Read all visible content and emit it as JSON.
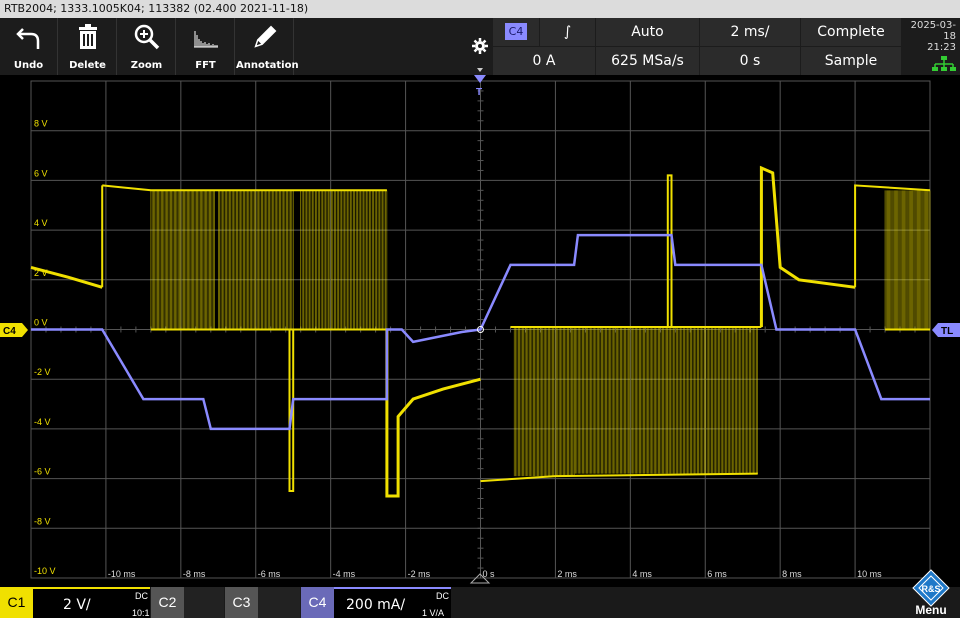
{
  "title_bar": {
    "text": "RTB2004; 1333.1005K04; 113382 (02.400 2021-11-18)"
  },
  "toolbar": {
    "undo_label": "Undo",
    "delete_label": "Delete",
    "zoom_label": "Zoom",
    "fft_label": "FFT",
    "annotation_label": "Annotation"
  },
  "trigger": {
    "source": "C4",
    "slope_symbol": "∫",
    "mode": "Auto",
    "level": "0 A",
    "sample_rate": "625 MSa/s"
  },
  "timebase": {
    "scale": "2 ms/",
    "position": "0 s"
  },
  "acquisition": {
    "status": "Complete",
    "mode": "Sample"
  },
  "datetime": {
    "date": "2025-03-18",
    "time": "21:23"
  },
  "markers": {
    "channel": "C4",
    "trigger_level": "TL",
    "trigger_top": "T"
  },
  "y_axis": {
    "labels": [
      "8 V",
      "6 V",
      "4 V",
      "2 V",
      "0 V",
      "-2 V",
      "-4 V",
      "-6 V",
      "-8 V",
      "-10 V"
    ],
    "values": [
      8,
      6,
      4,
      2,
      0,
      -2,
      -4,
      -6,
      -8,
      -10
    ]
  },
  "x_axis": {
    "labels": [
      "-10 ms",
      "-8 ms",
      "-6 ms",
      "-4 ms",
      "-2 ms",
      "0 s",
      "2 ms",
      "4 ms",
      "6 ms",
      "8 ms",
      "10 ms"
    ],
    "values": [
      -10,
      -8,
      -6,
      -4,
      -2,
      0,
      2,
      4,
      6,
      8,
      10
    ]
  },
  "channels": {
    "c1": {
      "label": "C1",
      "scale": "2 V/",
      "coupling": "DC",
      "probe": "10:1",
      "color": "#f0e000"
    },
    "c2": {
      "label": "C2"
    },
    "c3": {
      "label": "C3"
    },
    "c4": {
      "label": "C4",
      "scale": "200 mA/",
      "coupling": "DC",
      "probe": "1 V/A",
      "color": "#8a8aff"
    }
  },
  "menu": {
    "label": "Menu",
    "logo_text": "R&S"
  },
  "colors": {
    "grid": "#555555",
    "c1": "#f0e000",
    "c4": "#8a8aff",
    "tl": "#8a8aff"
  }
}
